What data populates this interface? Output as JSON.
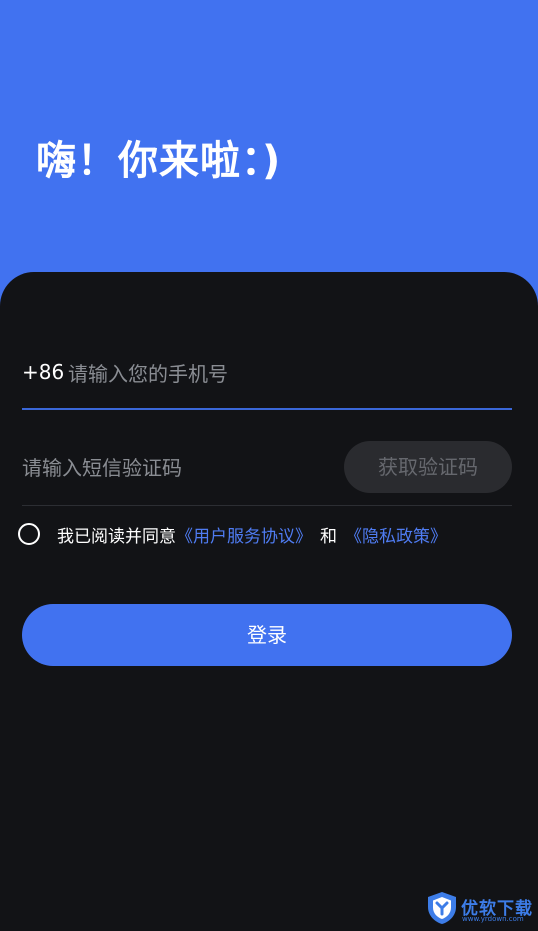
{
  "header": {
    "greeting": "嗨！你来啦：)"
  },
  "form": {
    "country_code": "+86",
    "phone_placeholder": "请输入您的手机号",
    "code_placeholder": "请输入短信验证码",
    "get_code_label": "获取验证码",
    "agreement": {
      "prefix": "我已阅读并同意",
      "user_agreement": "《用户服务协议》",
      "and": "和",
      "privacy_policy": "《隐私政策》"
    },
    "login_label": "登录"
  },
  "watermark": {
    "name": "优软下载",
    "url": "www.yrdown.com"
  },
  "colors": {
    "accent": "#4172f0",
    "panel_bg": "#121316",
    "link": "#4f7cf2",
    "watermark": "#3d7de8"
  }
}
